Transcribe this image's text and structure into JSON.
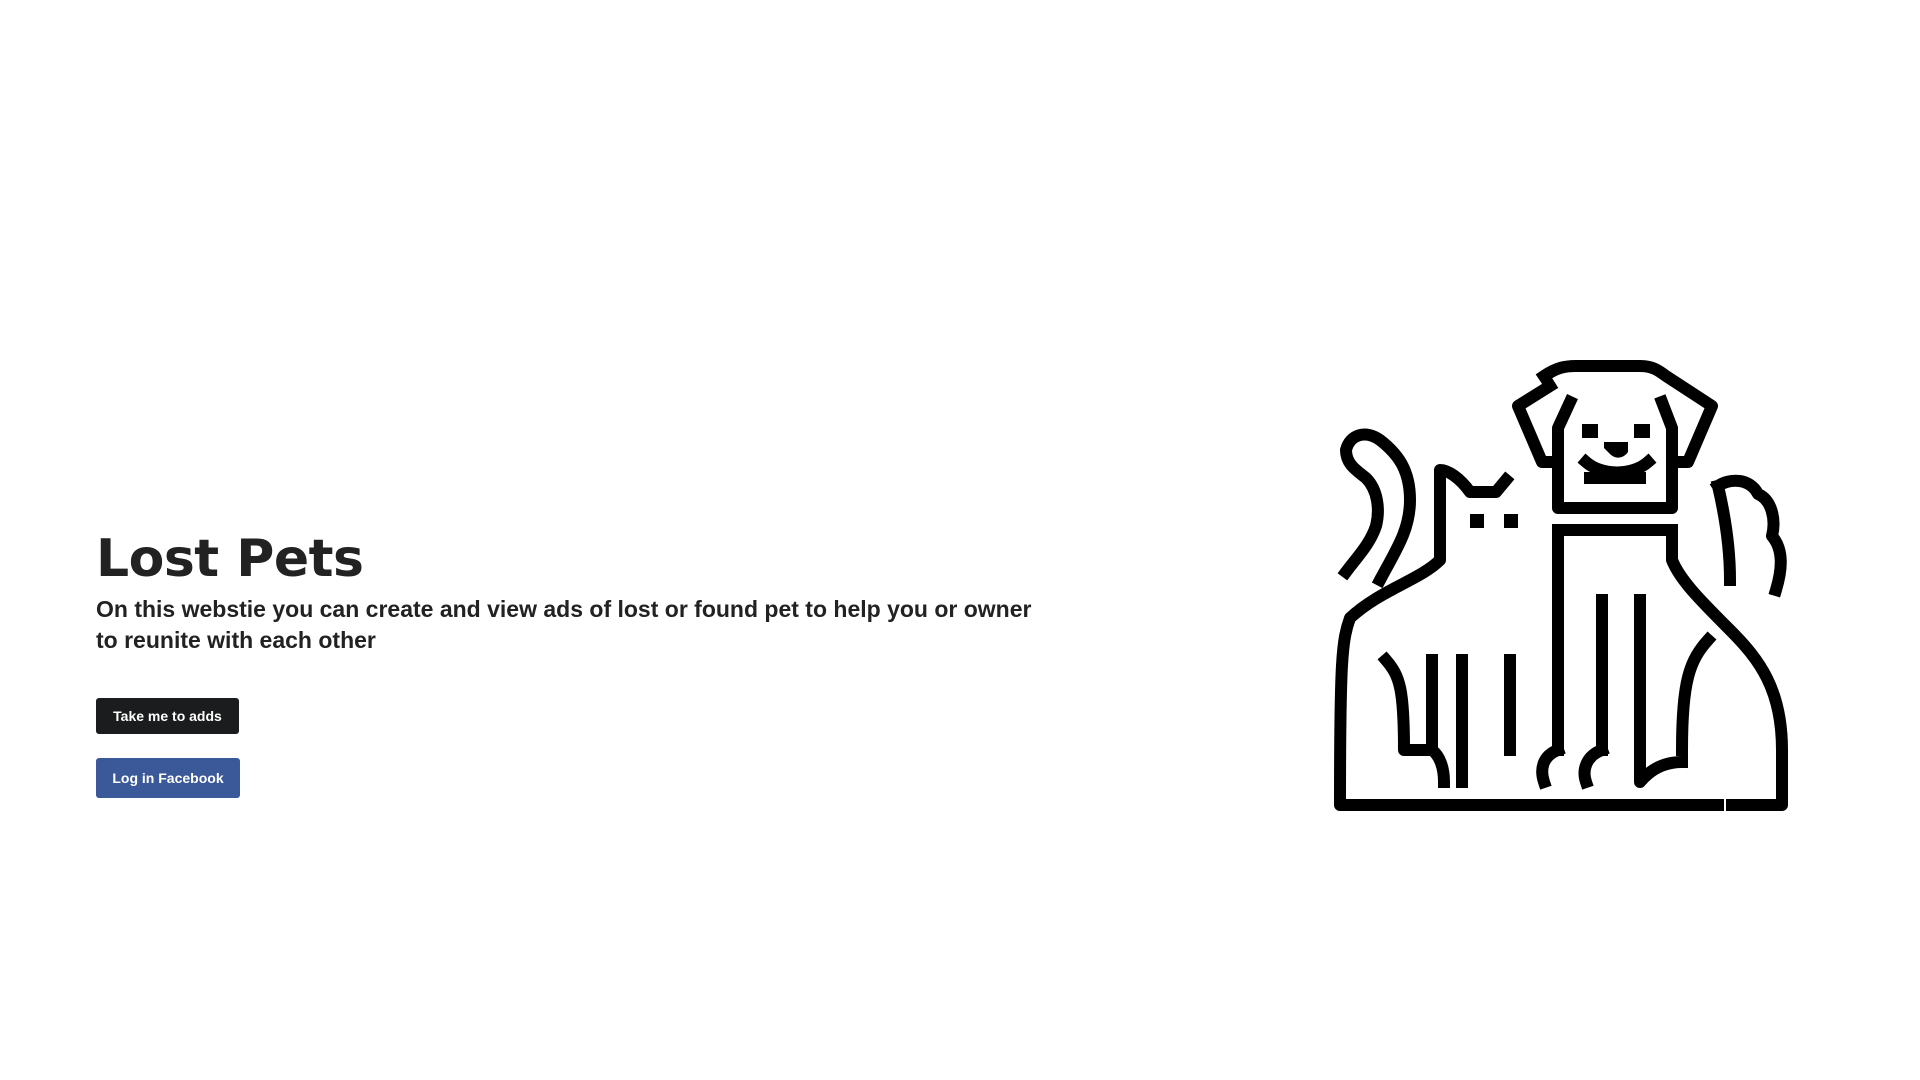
{
  "hero": {
    "title": "Lost Pets",
    "subtitle": "On this webstie you can create and view ads of lost or found pet to help you or owner to reunite with each other"
  },
  "buttons": {
    "adds_label": "Take me to adds",
    "facebook_label": "Log in Facebook"
  },
  "illustration": {
    "icon": "dog-and-cat-icon"
  },
  "colors": {
    "text": "#222222",
    "adds_button": "#1b1c1d",
    "facebook_button": "#3b5998",
    "background": "#ffffff"
  }
}
